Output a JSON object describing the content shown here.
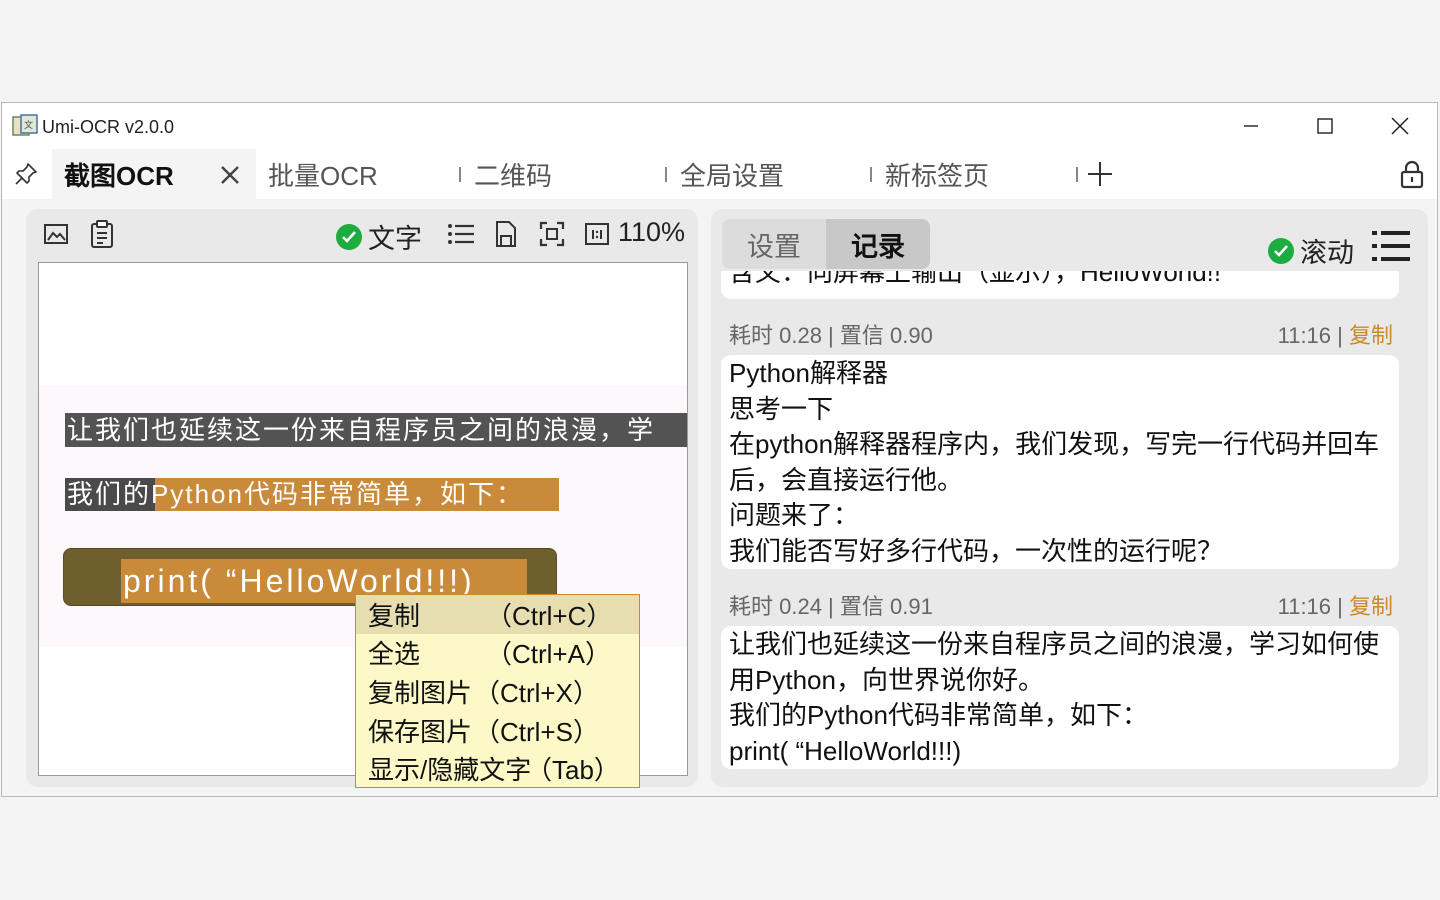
{
  "window": {
    "title": "Umi-OCR v2.0.0"
  },
  "tabs": [
    {
      "label": "截图OCR",
      "active": true
    },
    {
      "label": "批量OCR"
    },
    {
      "label": "二维码"
    },
    {
      "label": "全局设置"
    },
    {
      "label": "新标签页"
    }
  ],
  "left_panel": {
    "text_toggle": "文字",
    "zoom": "110%",
    "image_text": {
      "line1": "让我们也延续这一份来自程序员之间的浪漫，学",
      "line2_prefix": "我们的",
      "line2_highlight": "Python代码非常简单，如下：",
      "code": "print( “HelloWorld!!!)"
    }
  },
  "context_menu": {
    "items": [
      {
        "label": "复制",
        "shortcut": "（Ctrl+C）",
        "highlighted": true
      },
      {
        "label": "全选",
        "shortcut": "（Ctrl+A）"
      },
      {
        "label": "复制图片",
        "shortcut": "（Ctrl+X）"
      },
      {
        "label": "保存图片",
        "shortcut": "（Ctrl+S）"
      },
      {
        "label": "显示/隐藏文字",
        "shortcut": "（Tab）"
      }
    ]
  },
  "right_panel": {
    "tabs": [
      "设置",
      "记录"
    ],
    "active_tab": "记录",
    "scroll_toggle": "滚动",
    "records": [
      {
        "meta": "",
        "time": "",
        "copy": "",
        "lines": [
          "含义：向屏幕上输出（显示），HelloWorld!!"
        ]
      },
      {
        "meta": "耗时 0.28 | 置信 0.90",
        "time": "11:16 | ",
        "copy": "复制",
        "lines": [
          "Python解释器",
          "思考一下",
          "在python解释器程序内，我们发现，写完一行代码并回车",
          "后，会直接运行他。",
          "问题来了：",
          "我们能否写好多行代码，一次性的运行呢？"
        ]
      },
      {
        "meta": "耗时 0.24 | 置信 0.91",
        "time": "11:16 | ",
        "copy": "复制",
        "lines": [
          "让我们也延续这一份来自程序员之间的浪漫，学习如何使",
          "用Python，向世界说你好。",
          "我们的Python代码非常简单，如下：",
          "print( “HelloWorld!!!)"
        ]
      }
    ]
  },
  "colors": {
    "accent_orange": "#c98a2a",
    "check_green": "#1dac3f",
    "menu_bg": "#fdf8c8"
  }
}
